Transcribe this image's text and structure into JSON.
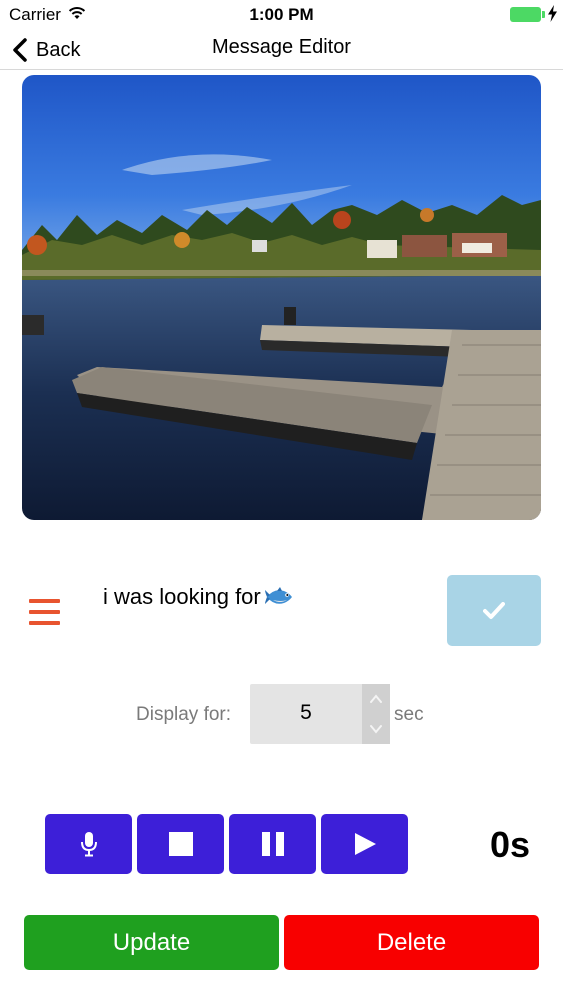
{
  "status_bar": {
    "carrier": "Carrier",
    "time": "1:00 PM",
    "icons": [
      "wifi-icon",
      "battery-icon",
      "charging-icon"
    ]
  },
  "nav": {
    "back_label": "Back",
    "title": "Message Editor"
  },
  "photo": {
    "description_icon": "photo-lake-dock"
  },
  "message": {
    "text": "i was looking for",
    "emoji": "fish-emoji",
    "menu_icon": "hamburger-icon",
    "confirm_icon": "checkmark-icon"
  },
  "duration": {
    "label": "Display for:",
    "value": "5",
    "unit": "sec"
  },
  "controls": {
    "record_icon": "microphone-icon",
    "stop_icon": "stop-icon",
    "pause_icon": "pause-icon",
    "play_icon": "play-icon",
    "timer": "0s"
  },
  "actions": {
    "update_label": "Update",
    "delete_label": "Delete"
  },
  "colors": {
    "accent_menu": "#e8542f",
    "confirm": "#a9d4e6",
    "media_buttons": "#3d1fd8",
    "update": "#1fa01f",
    "delete": "#f80000",
    "battery": "#4cd964"
  }
}
